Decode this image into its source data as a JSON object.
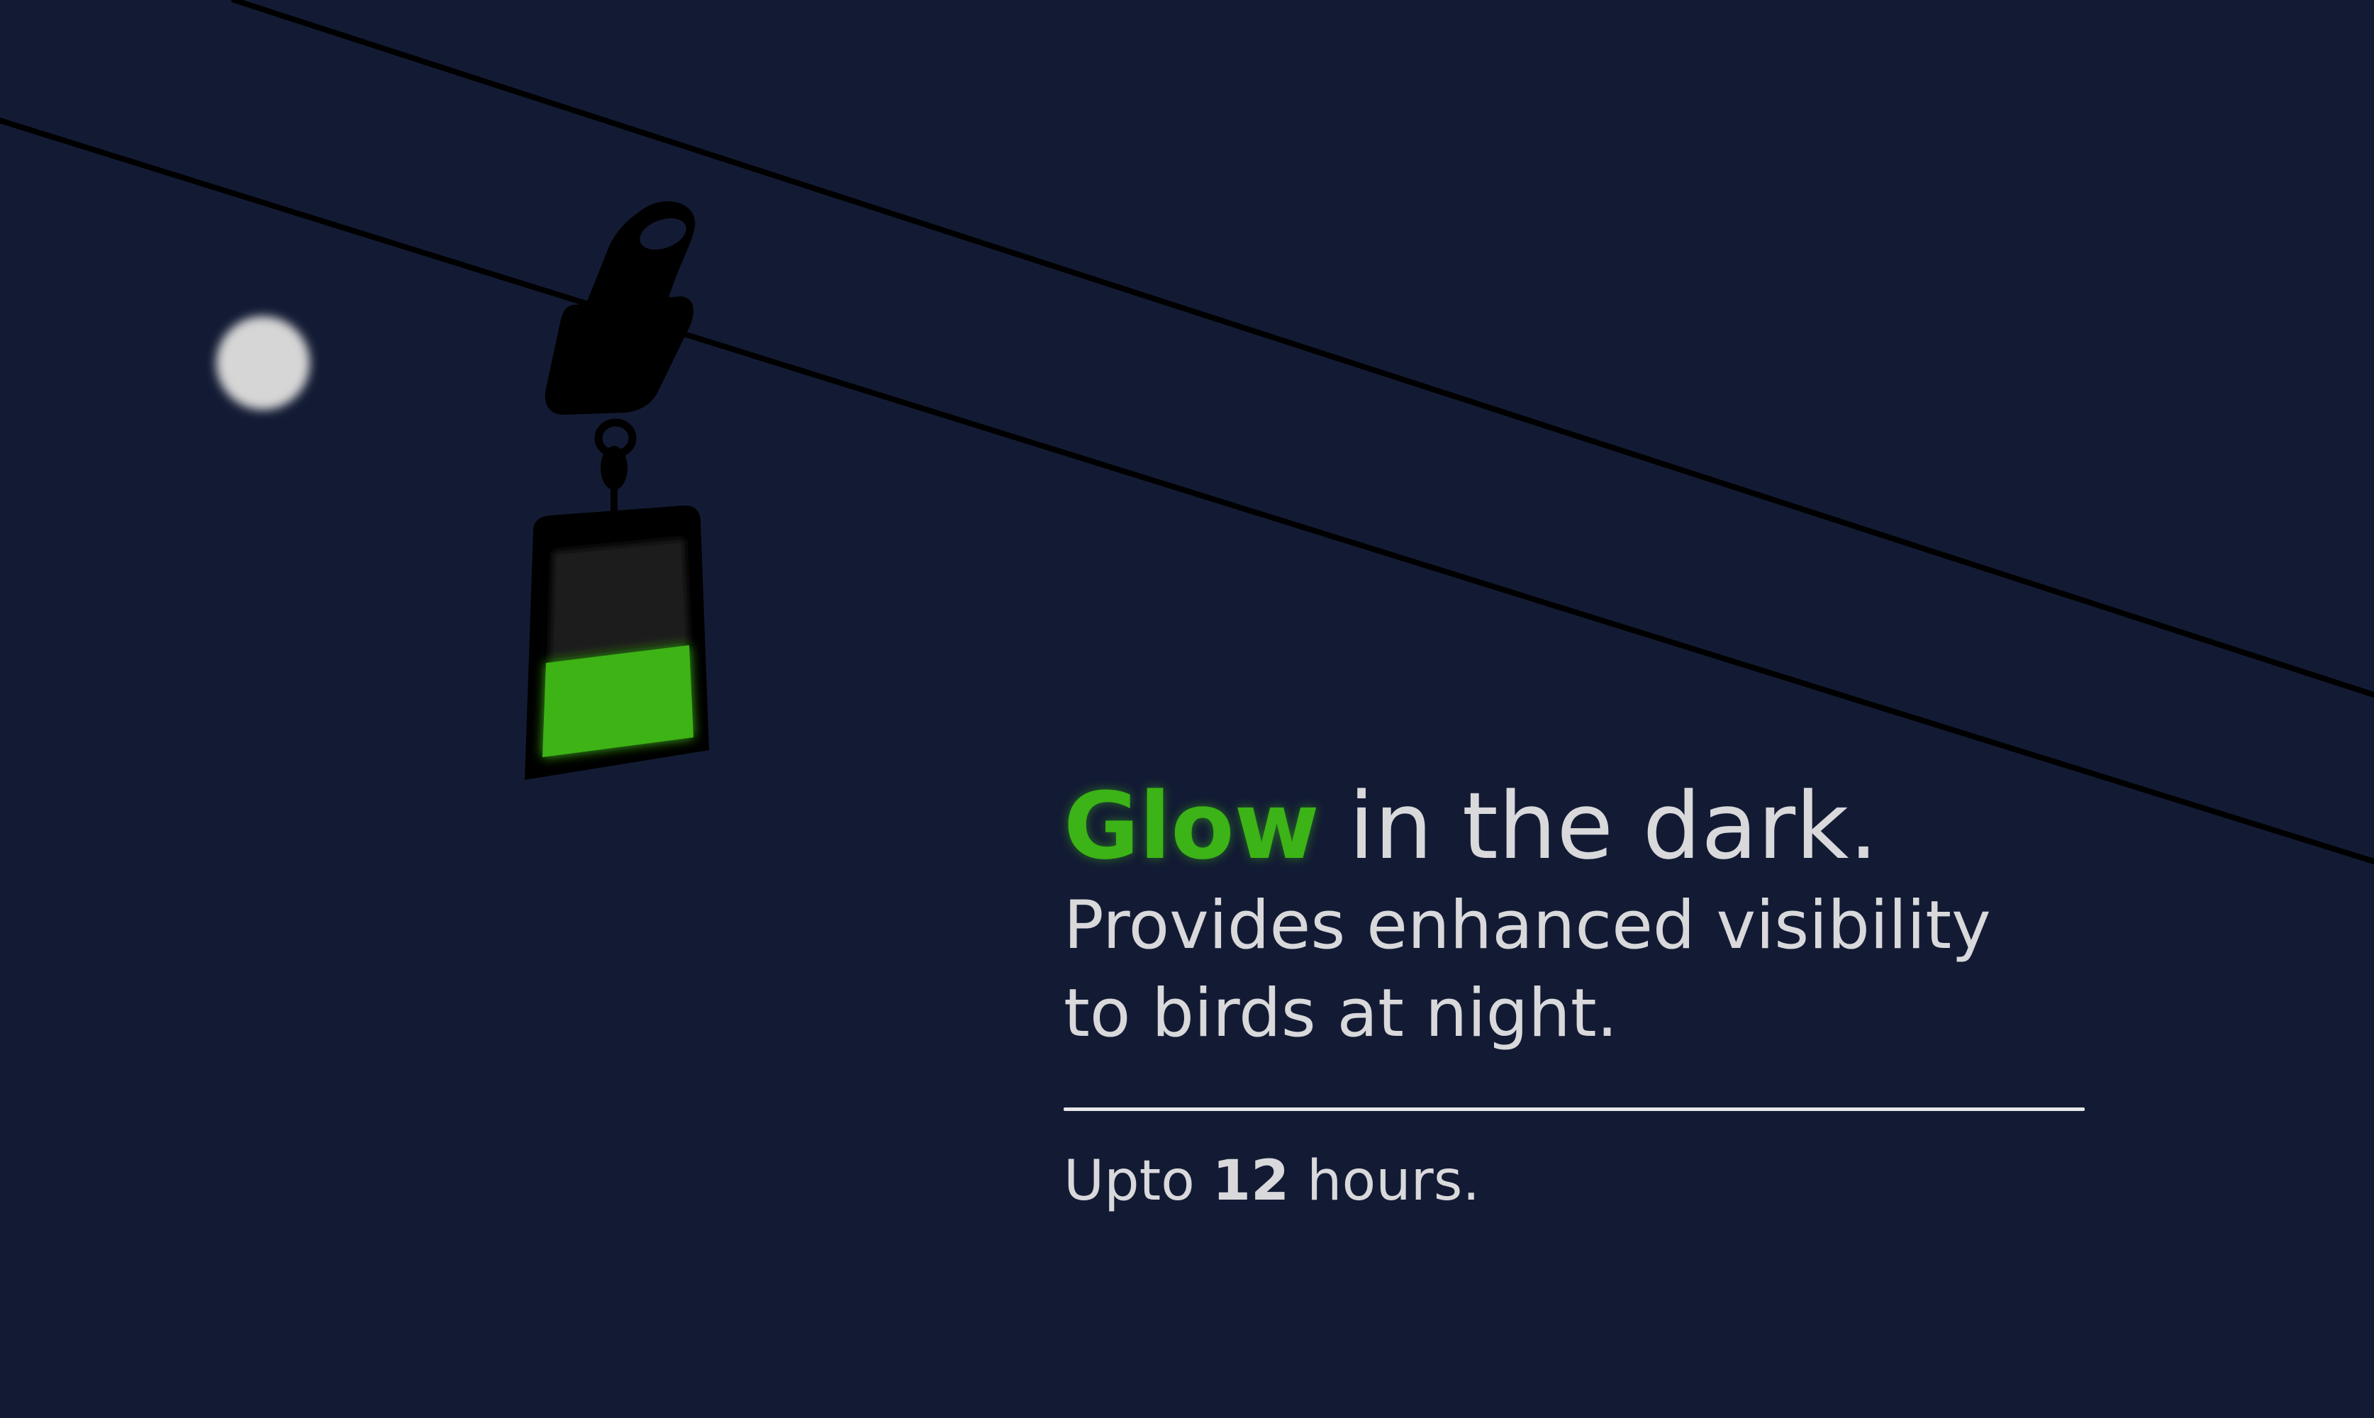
{
  "headline": {
    "highlight": "Glow",
    "rest": " in the dark."
  },
  "description": {
    "line1": "Provides enhanced visibility",
    "line2": "to birds at night."
  },
  "duration": {
    "prefix": "Upto ",
    "value": "12",
    "suffix": " hours."
  },
  "colors": {
    "background": "#131b34",
    "accent_green": "#3cb316",
    "text": "#d9d9dc",
    "moon": "#d6d6d6",
    "wire": "#000000"
  },
  "icons": {
    "moon": "moon-icon",
    "diverter": "bird-diverter-icon"
  }
}
